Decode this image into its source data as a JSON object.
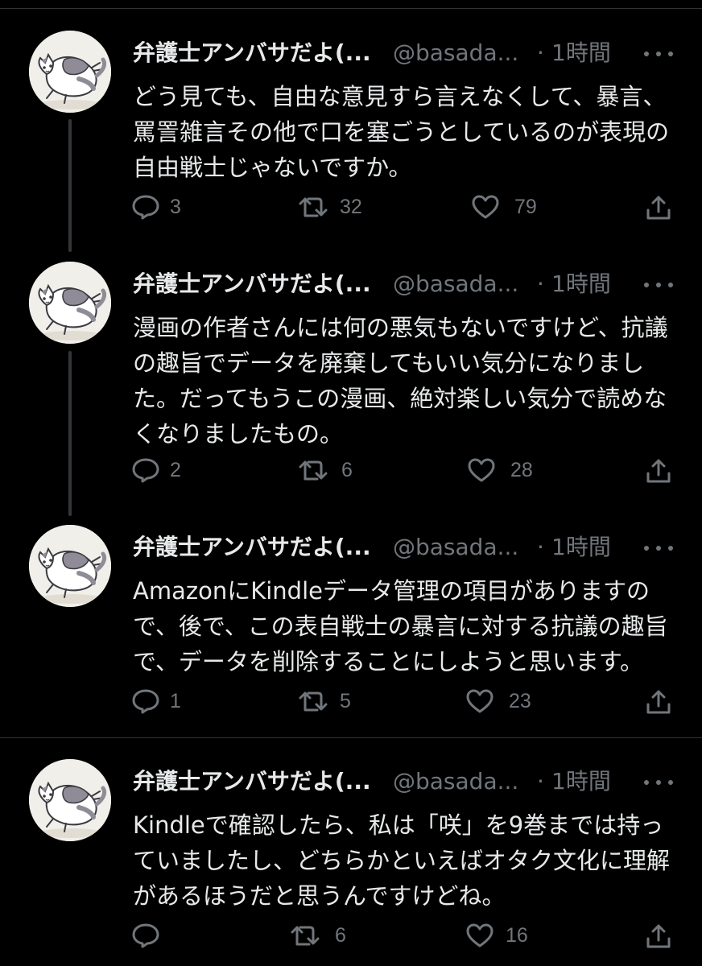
{
  "tweets": [
    {
      "name": "弁護士アンバサだよ(...",
      "handle": "@basada...",
      "dot": "·",
      "time": "1時間",
      "lines": [
        "どう見ても、自由な意見すら言えなくして、暴言、",
        "罵詈雑言その他で口を塞ごうとしているのが表現の",
        "自由戦士じゃないですか。"
      ],
      "replies": "3",
      "retweets": "32",
      "likes": "79"
    },
    {
      "name": "弁護士アンバサだよ(...",
      "handle": "@basada...",
      "dot": "·",
      "time": "1時間",
      "lines": [
        "漫画の作者さんには何の悪気もないですけど、抗議",
        "の趣旨でデータを廃棄してもいい気分になりまし",
        "た。だってもうこの漫画、絶対楽しい気分で読めな",
        "くなりましたもの。"
      ],
      "replies": "2",
      "retweets": "6",
      "likes": "28"
    },
    {
      "name": "弁護士アンバサだよ(...",
      "handle": "@basada...",
      "dot": "·",
      "time": "1時間",
      "lines": [
        "AmazonにKindleデータ管理の項目がありますの",
        "で、後で、この表自戦士の暴言に対する抗議の趣旨",
        "で、データを削除することにしようと思います。"
      ],
      "replies": "1",
      "retweets": "5",
      "likes": "23"
    },
    {
      "name": "弁護士アンバサだよ(...",
      "handle": "@basada...",
      "dot": "·",
      "time": "1時間",
      "lines": [
        "Kindleで確認したら、私は「咲」を9巻までは持っ",
        "ていましたし、どちらかといえばオタク文化に理解",
        "があるほうだと思うんですけどね。"
      ],
      "replies": "",
      "retweets": "6",
      "likes": "16"
    }
  ],
  "icons": {
    "reply": "reply-icon",
    "retweet": "retweet-icon",
    "like": "heart-icon",
    "share": "share-icon",
    "more": "more-icon",
    "avatar": "cat-avatar"
  },
  "colors": {
    "background": "#000000",
    "text": "#e7e9ea",
    "muted": "#71767b",
    "line": "#333639"
  }
}
